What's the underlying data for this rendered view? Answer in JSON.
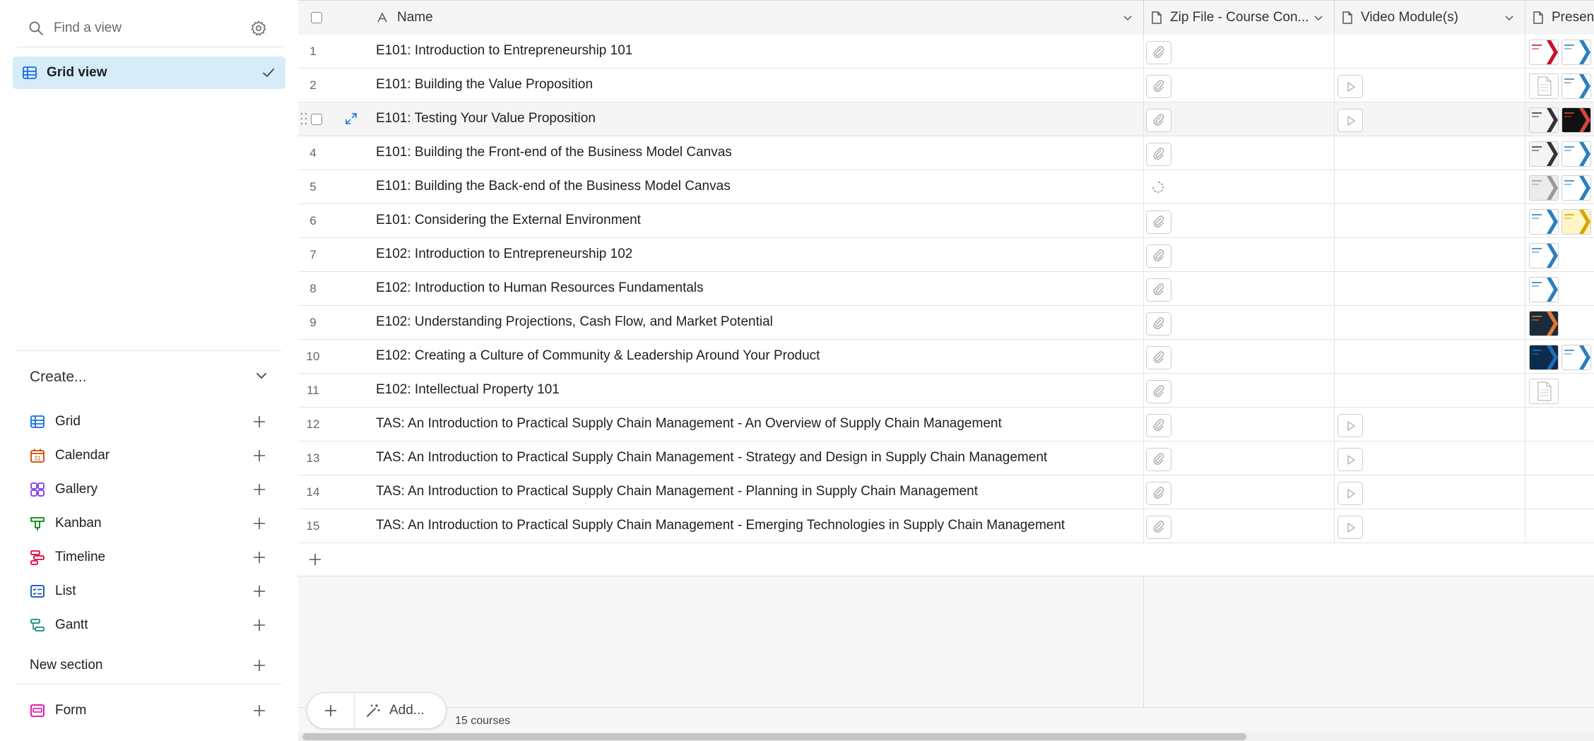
{
  "sidebar": {
    "search": {
      "placeholder": "Find a view"
    },
    "views": [
      {
        "label": "Grid view",
        "selected": true
      }
    ],
    "create": {
      "title": "Create...",
      "items": [
        {
          "label": "Grid",
          "icon": "grid-icon",
          "color": "#166ee1"
        },
        {
          "label": "Calendar",
          "icon": "calendar-icon",
          "color": "#d54401"
        },
        {
          "label": "Gallery",
          "icon": "gallery-icon",
          "color": "#7c39ed"
        },
        {
          "label": "Kanban",
          "icon": "kanban-icon",
          "color": "#048a0e"
        },
        {
          "label": "Timeline",
          "icon": "timeline-icon",
          "color": "#dc043b"
        },
        {
          "label": "List",
          "icon": "list-icon",
          "color": "#0d52ac"
        },
        {
          "label": "Gantt",
          "icon": "gantt-icon",
          "color": "#138a7b"
        }
      ],
      "new_section": "New section",
      "form": {
        "label": "Form",
        "icon": "form-icon",
        "color": "#dd04a8"
      }
    }
  },
  "table": {
    "columns": [
      {
        "label": "Name",
        "icon": "text-field-icon"
      },
      {
        "label": "Zip File - Course Con...",
        "icon": "file-field-icon"
      },
      {
        "label": "Video Module(s)",
        "icon": "file-field-icon"
      },
      {
        "label": "Presen",
        "icon": "file-field-icon"
      }
    ],
    "rows": [
      {
        "num": "1",
        "name": "E101: Introduction to Entrepreneurship 101",
        "video": false,
        "thumbs": [
          "red",
          "blue"
        ]
      },
      {
        "num": "2",
        "name": "E101: Building the Value Proposition",
        "video": true,
        "thumbs": [
          "doc",
          "blue"
        ]
      },
      {
        "num": "3",
        "name": "E101: Testing Your Value Proposition",
        "video": true,
        "thumbs": [
          "white",
          "dark"
        ]
      },
      {
        "num": "4",
        "name": "E101: Building the Front-end of the Business Model Canvas",
        "video": false,
        "thumbs": [
          "white",
          "blue"
        ]
      },
      {
        "num": "5",
        "name": "E101: Building the Back-end of the Business Model Canvas",
        "video": false,
        "loading": true,
        "thumbs": [
          "gray",
          "blue"
        ]
      },
      {
        "num": "6",
        "name": "E101: Considering the External Environment",
        "video": false,
        "thumbs": [
          "blue",
          "yellow"
        ]
      },
      {
        "num": "7",
        "name": "E102: Introduction to Entrepreneurship 102",
        "video": false,
        "thumbs": [
          "blue"
        ]
      },
      {
        "num": "8",
        "name": "E102: Introduction to Human Resources Fundamentals",
        "video": false,
        "thumbs": [
          "blue"
        ]
      },
      {
        "num": "9",
        "name": "E102: Understanding Projections, Cash Flow, and Market Potential",
        "video": false,
        "thumbs": [
          "orange"
        ]
      },
      {
        "num": "10",
        "name": "E102: Creating a Culture of Community & Leadership Around Your Product",
        "video": false,
        "thumbs": [
          "navy",
          "blue"
        ]
      },
      {
        "num": "11",
        "name": "E102: Intellectual Property 101",
        "video": false,
        "thumbs": [
          "doc"
        ]
      },
      {
        "num": "12",
        "name": "TAS: An Introduction to Practical Supply Chain Management - An Overview of Supply Chain Management",
        "video": true,
        "thumbs": []
      },
      {
        "num": "13",
        "name": "TAS: An Introduction to Practical Supply Chain Management - Strategy and Design in Supply Chain Management",
        "video": true,
        "thumbs": []
      },
      {
        "num": "14",
        "name": "TAS: An Introduction to Practical Supply Chain Management - Planning in Supply Chain Management",
        "video": true,
        "thumbs": []
      },
      {
        "num": "15",
        "name": "TAS: An Introduction to Practical Supply Chain Management - Emerging Technologies in Supply Chain Management",
        "video": true,
        "thumbs": []
      }
    ]
  },
  "footer": {
    "add_label": "Add...",
    "record_count": "15 courses"
  },
  "colors": {
    "selected_view_bg": "#d7ecf9",
    "accent": "#166ee1"
  }
}
